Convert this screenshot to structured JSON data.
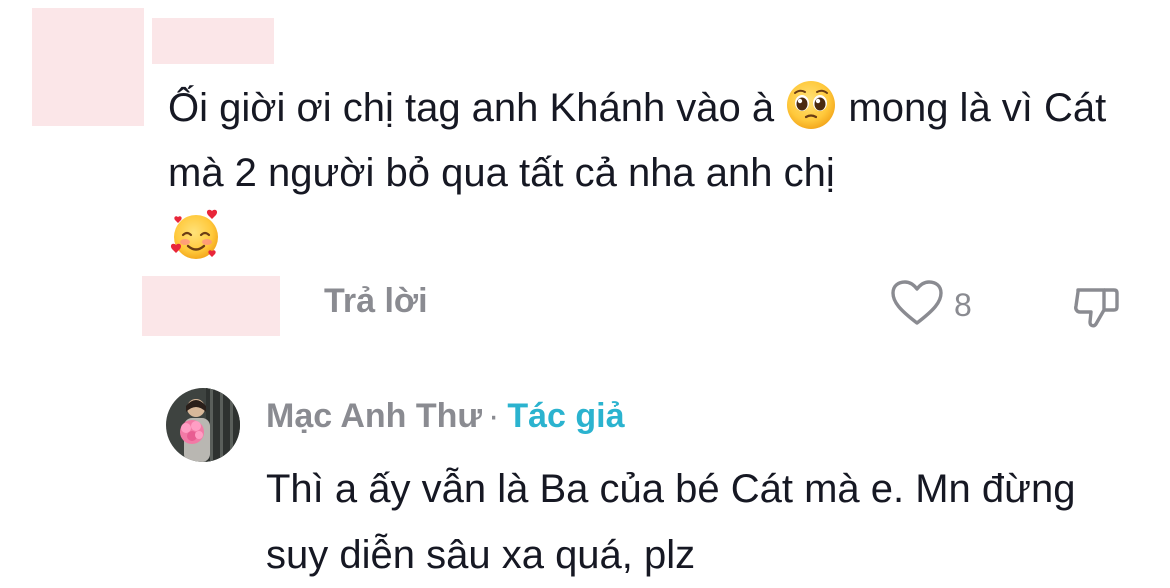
{
  "comment": {
    "line1_a": "Ối giời ơi chị tag anh Khánh vào à ",
    "line1_emoji": "pleading-face-emoji",
    "line1_b": " mong là vì Cát mà 2 người bỏ qua tất cả nha anh chị ",
    "line2_emoji": "smiling-face-with-hearts-emoji",
    "reply_label": "Trả lời",
    "like_count": "8",
    "like_icon": "heart-icon",
    "dislike_icon": "thumbs-down-icon"
  },
  "reply": {
    "author": "Mạc Anh Thư",
    "separator": "·",
    "author_badge": "Tác giả",
    "text": "Thì a ấy vẫn là Ba của bé Cát mà e. Mn đừng suy diễn sâu xa quá, plz"
  },
  "colors": {
    "text_primary": "#161823",
    "text_secondary": "#8a8b91",
    "badge": "#2bb3cf",
    "redaction": "#fbe6e8"
  }
}
